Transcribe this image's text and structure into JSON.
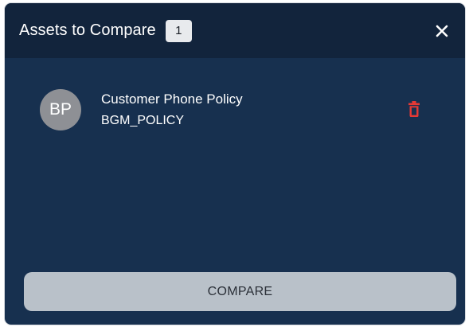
{
  "header": {
    "title": "Assets to Compare",
    "count": "1",
    "close_icon": "close-icon"
  },
  "assets": [
    {
      "initials": "BP",
      "name": "Customer Phone Policy",
      "type": "BGM_POLICY",
      "delete_icon": "trash-icon"
    }
  ],
  "footer": {
    "compare_label": "COMPARE"
  },
  "colors": {
    "panel_bg": "#17304f",
    "header_bg": "#12243c",
    "delete_red": "#e53935",
    "button_bg": "#b9c1c9",
    "avatar_bg": "#8e9095"
  }
}
